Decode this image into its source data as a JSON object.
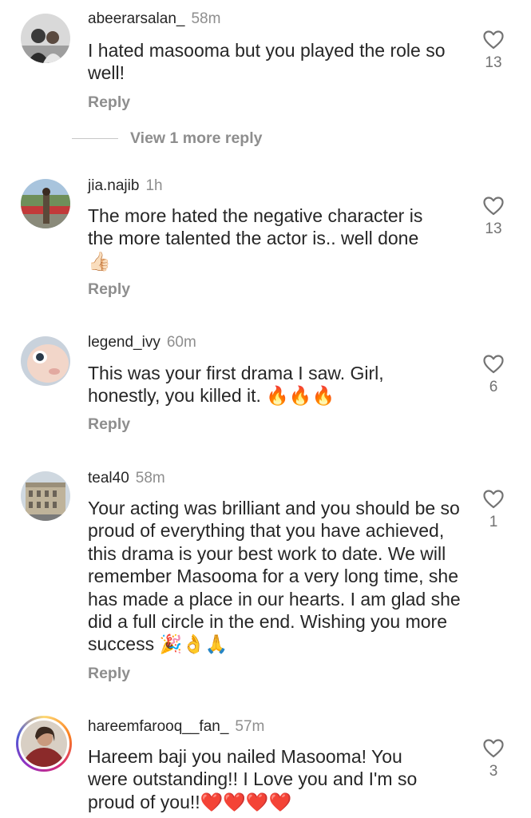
{
  "comments": [
    {
      "username": "abeerarsalan_",
      "time": "58m",
      "text": "I hated masooma but you played the role so well!",
      "likes": "13",
      "reply": "Reply"
    },
    {
      "username": "jia.najib",
      "time": "1h",
      "text": "The more hated the negative character is the more talented the actor is.. well done",
      "emoji": "👍🏻",
      "likes": "13",
      "reply": "Reply"
    },
    {
      "username": "legend_ivy",
      "time": "60m",
      "text": "This was your first drama I saw. Girl, honestly, you killed it.",
      "emoji": "🔥🔥🔥",
      "likes": "6",
      "reply": "Reply"
    },
    {
      "username": "teal40",
      "time": "58m",
      "text": "Your acting was brilliant and you should be so proud of everything that you have achieved, this drama is your best work to date. We will remember Masooma for a very long time, she has made a place in our hearts. I am glad she did a full circle in the end. Wishing you more success",
      "emoji": "🎉👌🙏",
      "likes": "1",
      "reply": "Reply"
    },
    {
      "username": "hareemfarooq__fan_",
      "time": "57m",
      "text": "Hareem baji you nailed Masooma! You were outstanding!! I Love you and I'm so proud of you!!",
      "emoji": "❤️❤️❤️❤️",
      "likes": "3"
    }
  ],
  "view_more": "View 1 more reply",
  "icons": {
    "like": "heart-outline-icon"
  }
}
